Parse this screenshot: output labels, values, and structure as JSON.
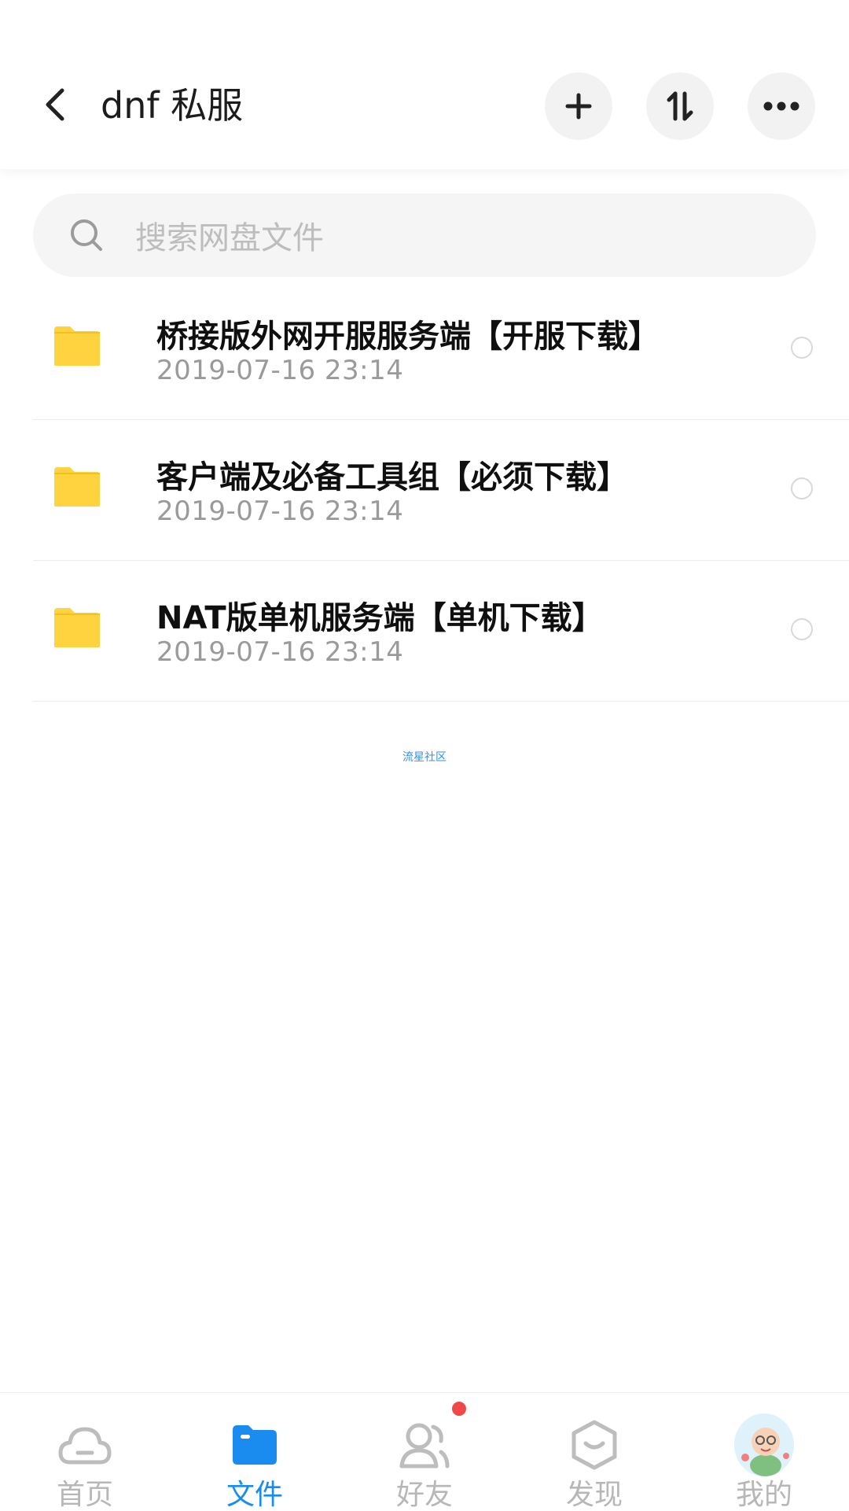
{
  "header": {
    "title": "dnf 私服"
  },
  "search": {
    "placeholder": "搜索网盘文件"
  },
  "files": [
    {
      "name": "桥接版外网开服服务端【开服下载】",
      "date": "2019-07-16  23:14"
    },
    {
      "name": "客户端及必备工具组【必须下载】",
      "date": "2019-07-16  23:14"
    },
    {
      "name": "NAT版单机服务端【单机下载】",
      "date": "2019-07-16  23:14"
    }
  ],
  "footer": {
    "link_text": "流星社区"
  },
  "nav": {
    "items": [
      {
        "label": "首页",
        "icon": "cloud-icon"
      },
      {
        "label": "文件",
        "icon": "folder-icon",
        "active": true
      },
      {
        "label": "好友",
        "icon": "friends-icon",
        "badge": true
      },
      {
        "label": "发现",
        "icon": "discover-icon"
      },
      {
        "label": "我的",
        "icon": "avatar-icon"
      }
    ]
  },
  "colors": {
    "accent": "#1a8cf0",
    "folder": "#ffd23f",
    "badge": "#f04848"
  }
}
